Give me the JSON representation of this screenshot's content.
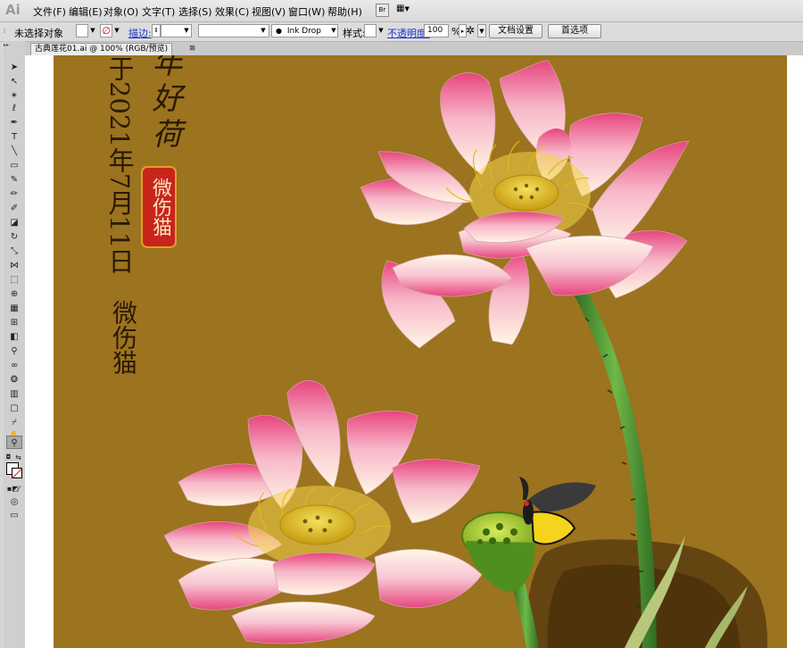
{
  "menubar": {
    "logo": "Ai",
    "items": [
      "文件(F)",
      "编辑(E)",
      "对象(O)",
      "文字(T)",
      "选择(S)",
      "效果(C)",
      "视图(V)",
      "窗口(W)",
      "帮助(H)"
    ],
    "bridge_label": "Br"
  },
  "control": {
    "no_selection": "未选择对象",
    "stroke_label": "描边:",
    "brush_name": "Ink Drop",
    "style_label": "样式:",
    "opacity_label": "不透明度:",
    "opacity_value": "100",
    "opacity_unit": "%",
    "doc_setup": "文档设置",
    "preferences": "首选项"
  },
  "document": {
    "tab_title": "古典莲花01.ai @ 100% (RGB/预览)",
    "close_glyph": "⊠"
  },
  "artwork": {
    "title_partial": "年好荷",
    "date_text": "于2021年7月11日",
    "seal_text": "微伤猫",
    "author_text": "微伤猫"
  },
  "colors": {
    "artboard": "#9c731e",
    "petal_pink": "#e8457e",
    "petal_cream": "#fff6e4",
    "stem_green": "#3f8a2c",
    "seal_red": "#c7251a"
  }
}
